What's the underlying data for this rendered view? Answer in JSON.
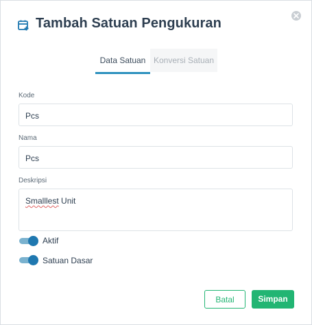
{
  "dialog": {
    "title": "Tambah Satuan Pengukuran",
    "tabs": [
      {
        "label": "Data Satuan",
        "active": true
      },
      {
        "label": "Konversi Satuan",
        "active": false
      }
    ]
  },
  "form": {
    "kode": {
      "label": "Kode",
      "value": "Pcs"
    },
    "nama": {
      "label": "Nama",
      "value": "Pcs"
    },
    "deskripsi": {
      "label": "Deskripsi",
      "value_prefix": "Smalllest",
      "value_suffix": " Unit"
    },
    "aktif": {
      "label": "Aktif",
      "on": true
    },
    "satuan_dasar": {
      "label": "Satuan Dasar",
      "on": true
    }
  },
  "actions": {
    "cancel_label": "Batal",
    "save_label": "Simpan"
  },
  "colors": {
    "accent": "#22b573",
    "toggle": "#1f78b0",
    "tab_underline": "#2a8fbd",
    "title": "#2d3e50"
  },
  "icons": {
    "title": "calendar-add-icon",
    "close": "close-icon"
  }
}
